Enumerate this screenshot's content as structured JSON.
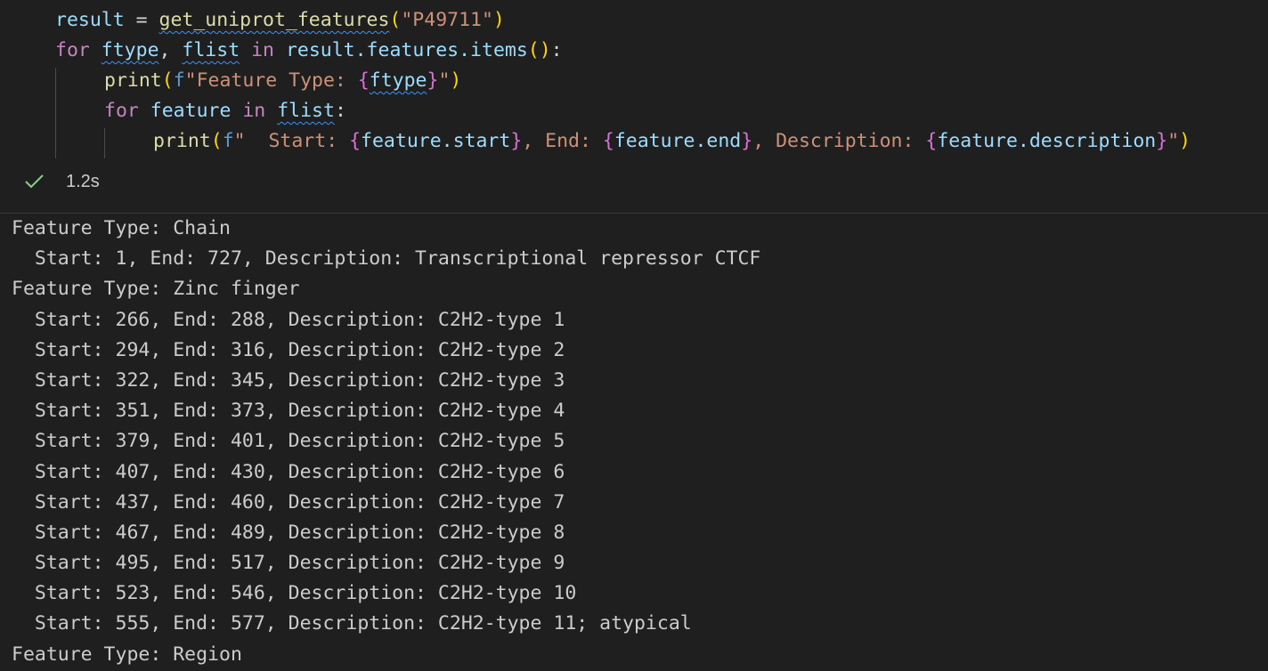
{
  "code": {
    "line1": {
      "var_result": "result",
      "op_eq": " = ",
      "fn_call": "get_uniprot_features",
      "paren_open": "(",
      "arg": "\"P49711\"",
      "paren_close": ")"
    },
    "line2": {
      "kw_for": "for",
      "var_ftype": "ftype",
      "comma": ", ",
      "var_flist": "flist",
      "kw_in": "in",
      "expr": "result.features.items",
      "call_parens": "()",
      "colon": ":"
    },
    "line3": {
      "fn_print": "print",
      "paren_open": "(",
      "fprefix": "f",
      "str_start": "\"Feature Type: ",
      "brace_open": "{",
      "var_ftype": "ftype",
      "brace_close": "}",
      "str_end": "\"",
      "paren_close": ")"
    },
    "line4": {
      "kw_for": "for",
      "var_feature": "feature",
      "kw_in": "in",
      "var_flist": "flist",
      "colon": ":"
    },
    "line5": {
      "fn_print": "print",
      "paren_open": "(",
      "fprefix": "f",
      "str1": "\"  Start: ",
      "b1o": "{",
      "v1": "feature.start",
      "b1c": "}",
      "str2": ", End: ",
      "b2o": "{",
      "v2": "feature.end",
      "b2c": "}",
      "str3": ", Description: ",
      "b3o": "{",
      "v3": "feature.description",
      "b3c": "}",
      "str4": "\"",
      "paren_close": ")"
    }
  },
  "status": {
    "check_icon": "checkmark-icon",
    "duration": "1.2s",
    "success_color": "#89d185"
  },
  "output_lines": [
    "Feature Type: Chain",
    "  Start: 1, End: 727, Description: Transcriptional repressor CTCF",
    "Feature Type: Zinc finger",
    "  Start: 266, End: 288, Description: C2H2-type 1",
    "  Start: 294, End: 316, Description: C2H2-type 2",
    "  Start: 322, End: 345, Description: C2H2-type 3",
    "  Start: 351, End: 373, Description: C2H2-type 4",
    "  Start: 379, End: 401, Description: C2H2-type 5",
    "  Start: 407, End: 430, Description: C2H2-type 6",
    "  Start: 437, End: 460, Description: C2H2-type 7",
    "  Start: 467, End: 489, Description: C2H2-type 8",
    "  Start: 495, End: 517, Description: C2H2-type 9",
    "  Start: 523, End: 546, Description: C2H2-type 10",
    "  Start: 555, End: 577, Description: C2H2-type 11; atypical",
    "Feature Type: Region"
  ]
}
